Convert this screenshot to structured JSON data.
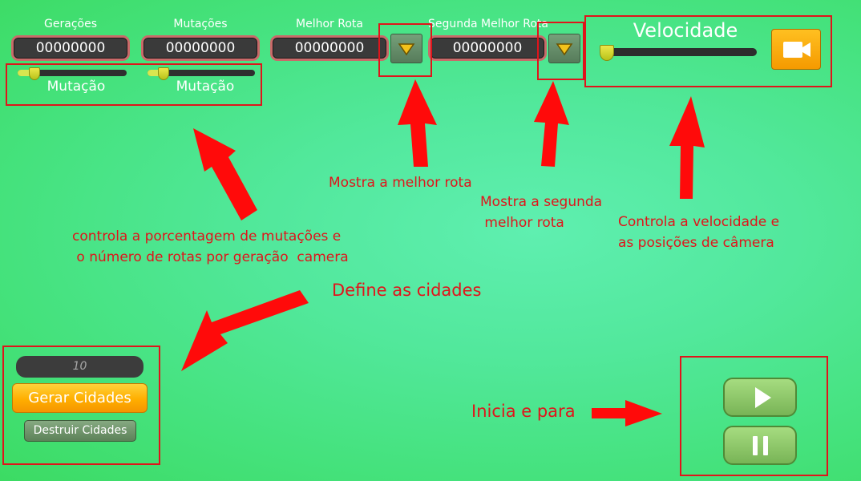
{
  "top": {
    "geracoes": {
      "label": "Gerações",
      "value": "00000000"
    },
    "mutacoes": {
      "label": "Mutações",
      "value": "00000000"
    },
    "melhor_rota": {
      "label": "Melhor Rota",
      "value": "00000000"
    },
    "segunda_rota": {
      "label": "Segunda Melhor Rota",
      "value": "00000000"
    },
    "mutacao_slider_1": {
      "label": "Mutação"
    },
    "mutacao_slider_2": {
      "label": "Mutação"
    },
    "velocidade": {
      "label": "Velocidade"
    }
  },
  "cities": {
    "count_input_value": "10",
    "gerar_label": "Gerar Cidades",
    "destruir_label": "Destruir Cidades"
  },
  "annotations": {
    "mostra_melhor": "Mostra a melhor rota",
    "mostra_segunda": "Mostra a segunda\n melhor rota",
    "controla_velocidade": "Controla a velocidade e\nas posições de câmera",
    "controla_porcentagem": "controla a porcentagem de mutações e\n o número de rotas por geração  camera",
    "define_cidades": "Define as cidades",
    "inicia_para": "Inicia e para"
  },
  "colors": {
    "annotation_red": "#e0141b",
    "field_border": "#c96a6a",
    "orange_button": "#ffb000",
    "green_button": "#8cc76b"
  },
  "icons": [
    "dropdown-triangle-icon",
    "camera-icon",
    "play-icon",
    "pause-icon"
  ]
}
